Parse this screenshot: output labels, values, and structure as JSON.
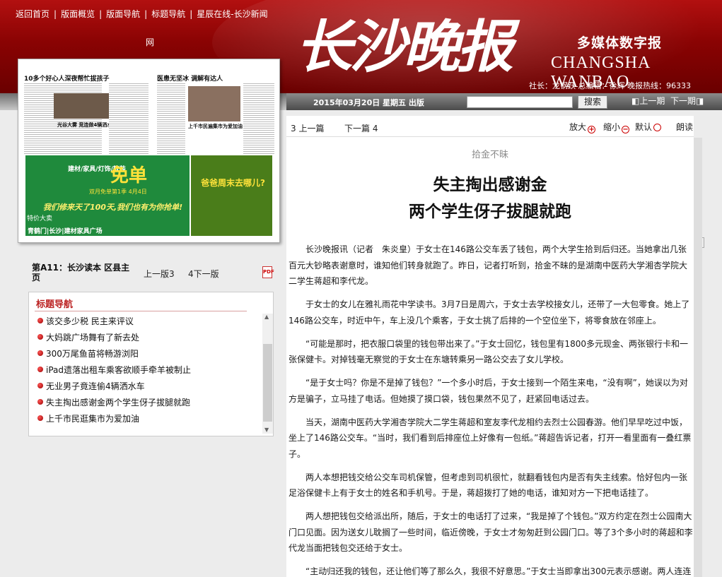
{
  "header": {
    "nav": [
      "返回首页",
      "版面概览",
      "版面导航",
      "标题导航",
      "星辰在线-长沙新闻"
    ],
    "nav_tail": "网",
    "logo_cn": "长沙晚报",
    "multimedia": "多媒体数字报",
    "logo_en": "CHANGSHA WANBAO",
    "staff": "社长：龙钢跃 总编辑：徐辉 晚报热线：96333"
  },
  "subbar": {
    "date": "2015年03月20日 星期五 出版",
    "search_button": "搜索",
    "prev_issue": "上一期",
    "next_issue": "下一期"
  },
  "thumbnail": {
    "headline_a": "10多个好心人深夜帮忙拔孩子",
    "headline_b": "医患无坚冰 调解有达人",
    "headline_c": "光谷大雾 竞连做4辆洒水车",
    "headline_d": "上千市民遍集市为爱加油",
    "ad_brand": "建材/家具/灯饰/软装",
    "ad_big": "免单",
    "ad_date": "双月免单第1季 4月4日",
    "ad_slogan": "我们修来天了100天,我们也有为你抢单!",
    "ad_partner": "特价大卖",
    "ad_location": "青鹤门|长沙|建材家具广场",
    "ad_right": "爸爸周末去哪儿?"
  },
  "page_info": {
    "label": "第A11：长沙读本 区县主页",
    "prev": "上一版3",
    "next": "4下一版",
    "pdf": "PDF"
  },
  "title_nav": {
    "heading": "标题导航",
    "items": [
      "该交多少税 民主来评议",
      "大妈跳广场舞有了新去处",
      "300万尾鱼苗将畅游浏阳",
      "iPad遗落出租车乘客欲顺手牵羊被制止",
      "无业男子竟连偷4辆洒水车",
      "失主掏出感谢金两个学生伢子拔腿就跑",
      "上千市民逛集市为爱加油"
    ]
  },
  "toolbar": {
    "prev_article": "3 上一篇",
    "next_article": "下一篇 4",
    "zoom_in": "放大",
    "zoom_out": "缩小",
    "default": "默认",
    "read": "朗读"
  },
  "article": {
    "kicker": "拾金不昧",
    "headline_1": "失主掏出感谢金",
    "headline_2": "两个学生伢子拔腿就跑",
    "paragraphs": [
      "长沙晚报讯（记者　朱炎皇）于女士在146路公交车丢了钱包，两个大学生拾到后归还。当她拿出几张百元大钞略表谢意时，谁知他们转身就跑了。昨日，记者打听到，拾金不昧的是湖南中医药大学湘杏学院大二学生蒋超和李代龙。",
      "于女士的女儿在雅礼雨花中学读书。3月7日是周六，于女士去学校接女儿，还带了一大包零食。她上了146路公交车，时近中午，车上没几个乘客，于女士挑了后排的一个空位坐下，将零食放在邻座上。",
      "“可能是那时，把衣服口袋里的钱包带出来了。”于女士回忆，钱包里有1800多元现金、两张银行卡和一张保健卡。对掉钱毫无察觉的于女士在东塘转乘另一路公交去了女儿学校。",
      "“是于女士吗？你是不是掉了钱包？”一个多小时后，于女士接到一个陌生来电，“没有啊”，她误以为对方是骗子，立马挂了电话。但她摸了摸口袋，钱包果然不见了，赶紧回电话过去。",
      "当天，湖南中医药大学湘杏学院大二学生蒋超和室友李代龙相约去烈士公园春游。他们早早吃过中饭，坐上了146路公交车。“当时，我们看到后排座位上好像有一包纸。”蒋超告诉记者，打开一看里面有一叠红票子。",
      "两人本想把钱交给公交车司机保管，但考虑到司机很忙，就翻看钱包内是否有失主线索。恰好包内一张足浴保健卡上有于女士的姓名和手机号。于是，蒋超拨打了她的电话，谁知对方一下把电话挂了。",
      "两人想把钱包交给派出所，随后，于女士的电话打了过来，“我是掉了个钱包。”双方约定在烈士公园南大门口见面。因为送女儿耽搁了一些时间，临近傍晚，于女士才匆匆赶到公园门口。等了3个多小时的蒋超和李代龙当面把钱包交还给于女士。",
      "“主动归还我的钱包，还让他们等了那么久，我很不好意思。”于女士当即拿出300元表示感谢。两人连连推辞，转身就跑。"
    ]
  }
}
